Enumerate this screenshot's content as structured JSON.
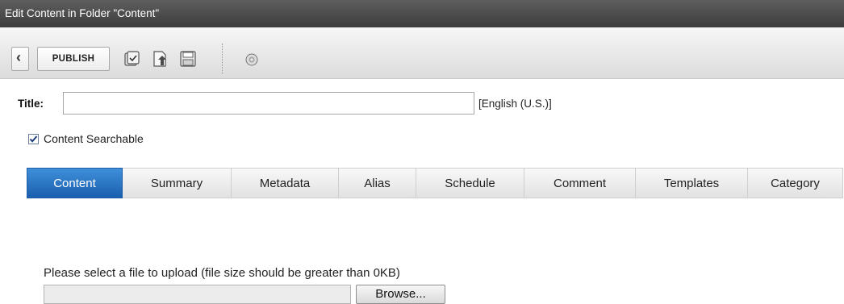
{
  "window": {
    "title": "Edit Content in Folder \"Content\""
  },
  "toolbar": {
    "back_icon": "chevron-left-icon",
    "publish_label": "PUBLISH",
    "icons": [
      "check-in-icon",
      "upload-icon",
      "save-icon",
      "help-icon"
    ]
  },
  "form": {
    "title_label": "Title:",
    "title_value": "",
    "language": "[English (U.S.)]",
    "searchable_label": "Content Searchable",
    "searchable_checked": true
  },
  "tabs": [
    {
      "label": "Content",
      "active": true
    },
    {
      "label": "Summary",
      "active": false
    },
    {
      "label": "Metadata",
      "active": false
    },
    {
      "label": "Alias",
      "active": false
    },
    {
      "label": "Schedule",
      "active": false
    },
    {
      "label": "Comment",
      "active": false
    },
    {
      "label": "Templates",
      "active": false
    },
    {
      "label": "Category",
      "active": false
    }
  ],
  "upload": {
    "instruction": "Please select a file to upload (file size should be greater than 0KB)",
    "file_value": "",
    "browse_label": "Browse..."
  },
  "colors": {
    "tab_active": "#2a78cc",
    "titlebar": "#4a4a4a"
  }
}
